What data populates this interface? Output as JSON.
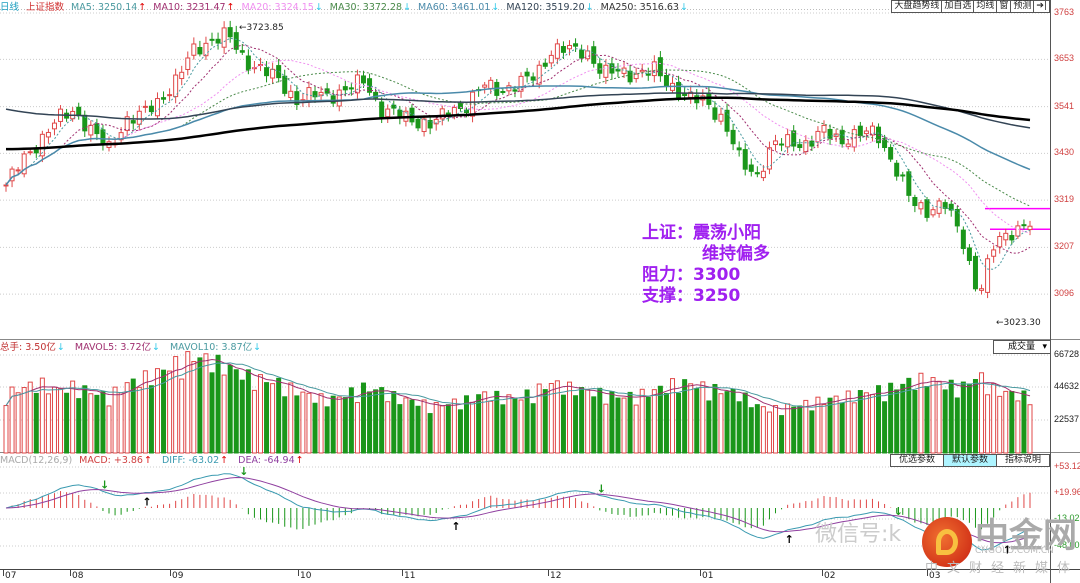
{
  "header": {
    "period": "日线",
    "index_name": "上证指数",
    "ma": [
      {
        "label": "MA5: 3250.14",
        "dir": "up",
        "color": "#4a9aa0"
      },
      {
        "label": "MA10: 3231.47",
        "dir": "up",
        "color": "#a03070"
      },
      {
        "label": "MA20: 3324.15",
        "dir": "down",
        "color": "#f090f0"
      },
      {
        "label": "MA30: 3372.28",
        "dir": "down",
        "color": "#4a8a4a"
      },
      {
        "label": "MA60: 3461.01",
        "dir": "down",
        "color": "#4a8aaa"
      },
      {
        "label": "MA120: 3519.20",
        "dir": "down",
        "color": "#334455"
      },
      {
        "label": "MA250: 3516.63",
        "dir": "down",
        "color": "#333333"
      }
    ],
    "buttons": [
      "大盘趋势线",
      "加自选",
      "均线",
      "窗",
      "预测"
    ],
    "collapse_icon": "collapse-right-icon"
  },
  "price_axis": [
    "3763",
    "3653",
    "3541",
    "3430",
    "3319",
    "3207",
    "3096"
  ],
  "price_levels": [
    3763,
    3653,
    3541,
    3430,
    3319,
    3207,
    3096
  ],
  "high_label": "3723.85",
  "low_label": "3023.30",
  "annotation": {
    "line1": "上证：震荡小阳",
    "line2": "维持偏多",
    "line3": "阻力：3300",
    "line4": "支撑：3250"
  },
  "resistance": 3300,
  "support": 3250,
  "volume_header": {
    "total": "总手: 3.50亿",
    "mavol5": "MAVOL5: 3.72亿",
    "mavol10": "MAVOL10: 3.87亿",
    "dropdown": "成交量"
  },
  "volume_axis": [
    "66728",
    "44632",
    "22537"
  ],
  "macd_header": {
    "name": "MACD(12,26,9)",
    "macd": "MACD: +3.86",
    "diff": "DIFF: -63.02",
    "dea": "DEA: -64.94",
    "buttons": [
      "优选参数",
      "默认参数",
      "指标说明"
    ]
  },
  "macd_axis": [
    "+53.12",
    "+19.96",
    "-13.02",
    "-48.00"
  ],
  "dates": [
    "07",
    "08",
    "09",
    "10",
    "11",
    "12",
    "01",
    "02",
    "03"
  ],
  "watermark": {
    "brand": "中金网",
    "domain": "CNGOLD.COM.CN",
    "slogan": "中文财经新媒体",
    "wechat": "微信号:k"
  },
  "colors": {
    "up": "#e04848",
    "down": "#1a961a",
    "accent": "#a020f0",
    "line": "#ff00ff"
  },
  "chart_data": {
    "type": "candlestick",
    "anchor_closes": [
      3355,
      3414,
      3462,
      3509,
      3533,
      3485,
      3438,
      3509,
      3521,
      3557,
      3604,
      3675,
      3699,
      3711,
      3651,
      3628,
      3604,
      3557,
      3569,
      3569,
      3581,
      3604,
      3533,
      3521,
      3509,
      3497,
      3533,
      3545,
      3592,
      3581,
      3592,
      3616,
      3675,
      3675,
      3675,
      3616,
      3628,
      3616,
      3628,
      3592,
      3557,
      3557,
      3509,
      3414,
      3379,
      3450,
      3462,
      3450,
      3485,
      3462,
      3473,
      3485,
      3402,
      3319,
      3296,
      3308,
      3236,
      3090,
      3224,
      3248,
      3260
    ],
    "anchor_volumes": [
      38000,
      42000,
      45000,
      40000,
      43000,
      39000,
      36000,
      44000,
      48000,
      52000,
      58000,
      62000,
      60000,
      55000,
      50000,
      47000,
      45000,
      40000,
      36000,
      34000,
      38000,
      42000,
      40000,
      35000,
      33000,
      30000,
      32000,
      34000,
      38000,
      36000,
      35000,
      40000,
      45000,
      42000,
      40000,
      38000,
      36000,
      37000,
      40000,
      44000,
      45000,
      42000,
      40000,
      38000,
      30000,
      28000,
      30000,
      32000,
      34000,
      36000,
      38000,
      40000,
      42000,
      46000,
      48000,
      44000,
      42000,
      50000,
      40000,
      38000,
      36000
    ]
  }
}
